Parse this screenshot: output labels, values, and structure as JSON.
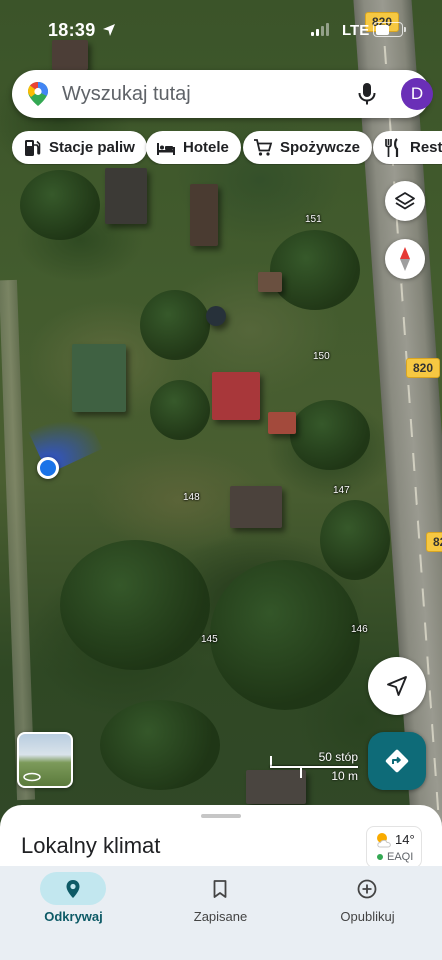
{
  "status_bar": {
    "time": "18:39",
    "network": "LTE"
  },
  "search": {
    "placeholder": "Wyszukaj tutaj",
    "avatar_letter": "D"
  },
  "chips": [
    {
      "label": "Stacje paliw",
      "icon": "gas-station-icon"
    },
    {
      "label": "Hotele",
      "icon": "bed-icon"
    },
    {
      "label": "Spożywcze",
      "icon": "cart-icon"
    },
    {
      "label": "Resta",
      "icon": "fork-knife-icon"
    }
  ],
  "map": {
    "route_number": "820",
    "house_numbers": [
      "151",
      "150",
      "148",
      "147",
      "145",
      "146"
    ]
  },
  "scale": {
    "imperial": "50 stóp",
    "metric": "10 m"
  },
  "sheet": {
    "title": "Lokalny klimat",
    "weather": {
      "temp": "14°",
      "aqi": "EAQI"
    }
  },
  "nav": [
    {
      "label": "Odkrywaj",
      "icon": "explore-pin-icon",
      "active": true
    },
    {
      "label": "Zapisane",
      "icon": "bookmark-icon",
      "active": false
    },
    {
      "label": "Opublikuj",
      "icon": "add-circle-icon",
      "active": false
    }
  ],
  "colors": {
    "accent": "#0e6b78",
    "avatar": "#6a2fb7",
    "location_dot": "#1a73e8",
    "route_shield": "#f6c842"
  }
}
